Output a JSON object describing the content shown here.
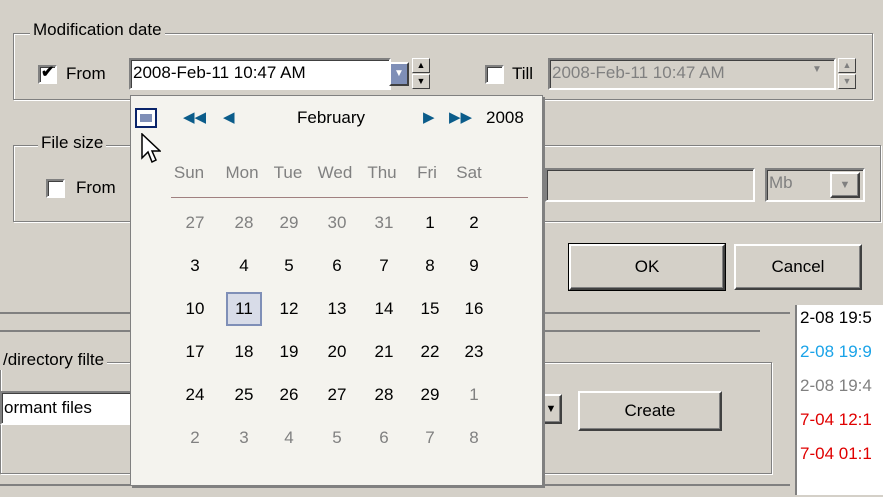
{
  "modification_date": {
    "title": "Modification date",
    "from_label": "From",
    "from_checked": true,
    "from_value": "2008-Feb-11 10:47 AM",
    "till_label": "Till",
    "till_checked": false,
    "till_value": "2008-Feb-11 10:47 AM"
  },
  "file_size": {
    "title": "File size",
    "from_label": "From",
    "unit": "Mb"
  },
  "buttons": {
    "ok": "OK",
    "cancel": "Cancel",
    "create": "Create"
  },
  "filter": {
    "title": "/directory filte",
    "value": "ormant files"
  },
  "calendar": {
    "month": "February",
    "year": "2008",
    "weekdays": [
      "Sun",
      "Mon",
      "Tue",
      "Wed",
      "Thu",
      "Fri",
      "Sat"
    ],
    "weeks": [
      [
        {
          "d": "27",
          "o": true
        },
        {
          "d": "28",
          "o": true
        },
        {
          "d": "29",
          "o": true
        },
        {
          "d": "30",
          "o": true
        },
        {
          "d": "31",
          "o": true
        },
        {
          "d": "1"
        },
        {
          "d": "2"
        }
      ],
      [
        {
          "d": "3"
        },
        {
          "d": "4"
        },
        {
          "d": "5"
        },
        {
          "d": "6"
        },
        {
          "d": "7"
        },
        {
          "d": "8"
        },
        {
          "d": "9"
        }
      ],
      [
        {
          "d": "10"
        },
        {
          "d": "11",
          "s": true
        },
        {
          "d": "12"
        },
        {
          "d": "13"
        },
        {
          "d": "14"
        },
        {
          "d": "15"
        },
        {
          "d": "16"
        }
      ],
      [
        {
          "d": "17"
        },
        {
          "d": "18"
        },
        {
          "d": "19"
        },
        {
          "d": "20"
        },
        {
          "d": "21"
        },
        {
          "d": "22"
        },
        {
          "d": "23"
        }
      ],
      [
        {
          "d": "24"
        },
        {
          "d": "25"
        },
        {
          "d": "26"
        },
        {
          "d": "27"
        },
        {
          "d": "28"
        },
        {
          "d": "29"
        },
        {
          "d": "1",
          "o": true
        }
      ],
      [
        {
          "d": "2",
          "o": true
        },
        {
          "d": "3",
          "o": true
        },
        {
          "d": "4",
          "o": true
        },
        {
          "d": "5",
          "o": true
        },
        {
          "d": "6",
          "o": true
        },
        {
          "d": "7",
          "o": true
        },
        {
          "d": "8",
          "o": true
        }
      ]
    ]
  },
  "right_list": [
    {
      "text": "2-08 19:5",
      "color": "#000000"
    },
    {
      "text": "2-08 19:9",
      "color": "#1aa3e8"
    },
    {
      "text": "2-08 19:4",
      "color": "#808080"
    },
    {
      "text": "7-04 12:1",
      "color": "#e00000"
    },
    {
      "text": "7-04 01:1",
      "color": "#e00000"
    }
  ]
}
